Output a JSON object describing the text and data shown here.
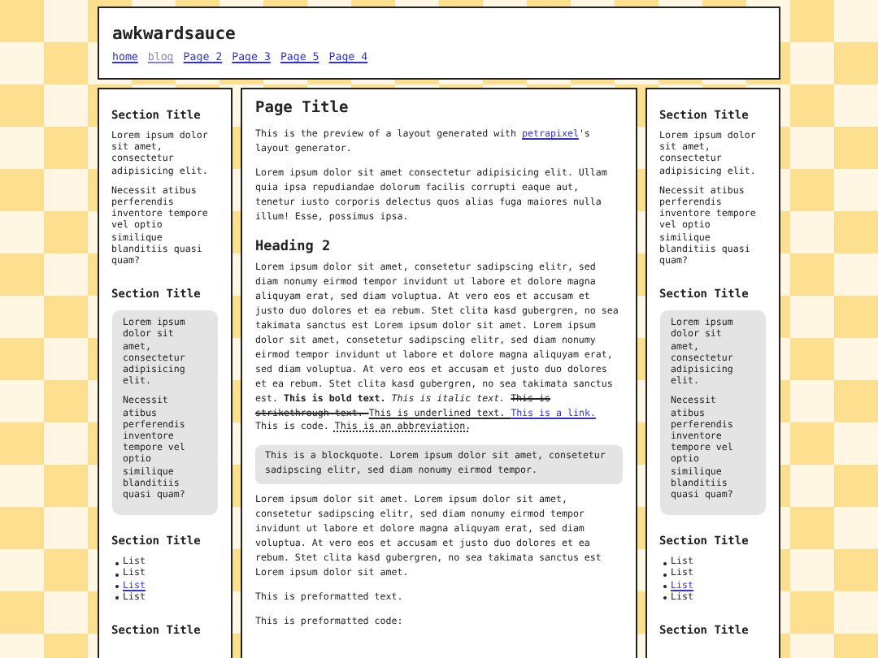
{
  "header": {
    "title": "awkwardsauce",
    "nav": [
      {
        "label": "home",
        "visited": false
      },
      {
        "label": "blog",
        "visited": true
      },
      {
        "label": "Page 2",
        "visited": false
      },
      {
        "label": "Page 3",
        "visited": false
      },
      {
        "label": "Page 5",
        "visited": false
      },
      {
        "label": "Page 4",
        "visited": false
      }
    ]
  },
  "left_sidebar": {
    "sections": [
      {
        "kind": "text",
        "title": "Section Title",
        "paragraphs": [
          "Lorem ipsum dolor sit amet, consectetur adipisicing elit.",
          "Necessit atibus perferendis inventore tempore vel optio similique blanditiis quasi quam?"
        ]
      },
      {
        "kind": "box",
        "title": "Section Title",
        "paragraphs": [
          "Lorem ipsum dolor sit amet, consectetur adipisicing elit.",
          "Necessit atibus perferendis inventore tempore vel optio similique blanditiis quasi quam?"
        ]
      },
      {
        "kind": "list",
        "title": "Section Title",
        "items": [
          {
            "text": "List",
            "link": false
          },
          {
            "text": "List",
            "link": false
          },
          {
            "text": "List",
            "link": true
          },
          {
            "text": "List",
            "link": false
          }
        ]
      },
      {
        "kind": "text",
        "title": "Section Title"
      }
    ]
  },
  "main": {
    "title": "Page Title",
    "blocks": [
      {
        "kind": "para",
        "segments": [
          {
            "kind": "text",
            "text": "This is the preview of a layout generated with "
          },
          {
            "kind": "link",
            "text": "petrapixel"
          },
          {
            "kind": "text",
            "text": "'s layout generator."
          }
        ]
      },
      {
        "kind": "para",
        "segments": [
          {
            "kind": "text",
            "text": "Lorem ipsum dolor sit amet consectetur adipisicing elit. Ullam quia ipsa repudiandae dolorum facilis corrupti eaque aut, tenetur iusto corporis delectus quos alias fuga maiores nulla illum! Esse, possimus ipsa."
          }
        ]
      },
      {
        "kind": "heading",
        "text": "Heading 2"
      },
      {
        "kind": "para",
        "segments": [
          {
            "kind": "text",
            "text": "Lorem ipsum dolor sit amet, consetetur sadipscing elitr, sed diam nonumy eirmod tempor invidunt ut labore et dolore magna aliquyam erat, sed diam voluptua. At vero eos et accusam et justo duo dolores et ea rebum. Stet clita kasd gubergren, no sea takimata sanctus est Lorem ipsum dolor sit amet. Lorem ipsum dolor sit amet, consetetur sadipscing elitr, sed diam nonumy eirmod tempor invidunt ut labore et dolore magna aliquyam erat, sed diam voluptua. At vero eos et accusam et justo duo dolores et ea rebum. Stet clita kasd gubergren, no sea takimata sanctus est. "
          },
          {
            "kind": "bold",
            "text": "This is bold text. "
          },
          {
            "kind": "italic",
            "text": "This is italic text. "
          },
          {
            "kind": "strike",
            "text": "This is strikethrough text. "
          },
          {
            "kind": "underline",
            "text": "This is underlined text. "
          },
          {
            "kind": "link",
            "text": "This is a link."
          },
          {
            "kind": "text",
            "text": " This is code. "
          },
          {
            "kind": "abbr",
            "text": "This is an abbreviation."
          }
        ]
      },
      {
        "kind": "quote",
        "text": "This is a blockquote. Lorem ipsum dolor sit amet, consetetur sadipscing elitr, sed diam nonumy eirmod tempor."
      },
      {
        "kind": "para",
        "segments": [
          {
            "kind": "text",
            "text": "Lorem ipsum dolor sit amet. Lorem ipsum dolor sit amet, consetetur sadipscing elitr, sed diam nonumy eirmod tempor invidunt ut labore et dolore magna aliquyam erat, sed diam voluptua. At vero eos et accusam et justo duo dolores et ea rebum. Stet clita kasd gubergren, no sea takimata sanctus est Lorem ipsum dolor sit amet."
          }
        ]
      },
      {
        "kind": "pre",
        "text": "This is preformatted text."
      },
      {
        "kind": "pre",
        "text": "This is preformatted code:"
      }
    ]
  },
  "right_sidebar": {
    "sections": [
      {
        "kind": "text",
        "title": "Section Title",
        "paragraphs": [
          "Lorem ipsum dolor sit amet, consectetur adipisicing elit.",
          "Necessit atibus perferendis inventore tempore vel optio similique blanditiis quasi quam?"
        ]
      },
      {
        "kind": "box",
        "title": "Section Title",
        "paragraphs": [
          "Lorem ipsum dolor sit amet, consectetur adipisicing elit.",
          "Necessit atibus perferendis inventore tempore vel optio similique blanditiis quasi quam?"
        ]
      },
      {
        "kind": "list",
        "title": "Section Title",
        "items": [
          {
            "text": "List",
            "link": false
          },
          {
            "text": "List",
            "link": false
          },
          {
            "text": "List",
            "link": true
          },
          {
            "text": "List",
            "link": false
          }
        ]
      },
      {
        "kind": "text",
        "title": "Section Title"
      }
    ]
  }
}
